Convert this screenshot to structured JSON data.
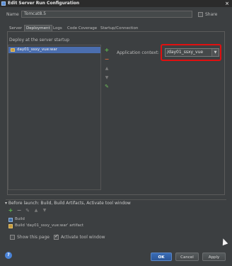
{
  "window": {
    "title": "Edit Server Run Configuration",
    "close": "×"
  },
  "name_row": {
    "label": "Name",
    "value": "Tomcat8.5",
    "share_label": "Share",
    "share_checked": false
  },
  "tabs": [
    {
      "label": "Server",
      "active": false
    },
    {
      "label": "Deployment",
      "active": true
    },
    {
      "label": "Logs",
      "active": false
    },
    {
      "label": "Code Coverage",
      "active": false
    },
    {
      "label": "Startup/Connection",
      "active": false
    }
  ],
  "deployment": {
    "section_label": "Deploy at the server startup",
    "artifacts": [
      "day01_ssxy_vue:war"
    ],
    "toolbar_icons": [
      "add-icon",
      "remove-icon",
      "move-up-icon",
      "move-down-icon",
      "edit-icon"
    ],
    "app_context_label": "Application context:",
    "app_context_value": "/day01_ssxy_vue"
  },
  "before_launch": {
    "header": "Before launch: Build, Build Artifacts, Activate tool window",
    "items": [
      "Build",
      "Build 'day01_ssxy_vue:war' artifact"
    ],
    "show_page_label": "Show this page",
    "show_page_checked": false,
    "activate_tool_label": "Activate tool window",
    "activate_tool_checked": true
  },
  "buttons": {
    "ok": "OK",
    "cancel": "Cancel",
    "apply": "Apply",
    "help": "?"
  },
  "colors": {
    "highlight": "#e01010",
    "selection": "#4b6eaf",
    "add": "#5fbf4f",
    "remove": "#d36a3a"
  }
}
